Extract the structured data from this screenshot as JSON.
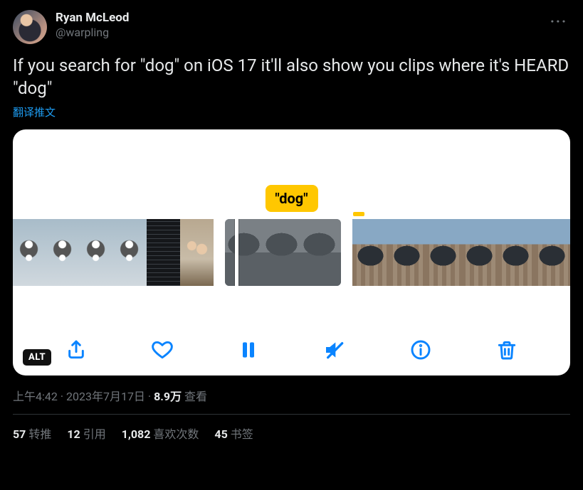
{
  "author": {
    "display_name": "Ryan McLeod",
    "handle": "@warpling"
  },
  "tweet_text": "If you search for \"dog\" on iOS 17 it'll also show you clips where it's HEARD \"dog\"",
  "translate_label": "翻译推文",
  "media": {
    "search_tooltip": "\"dog\"",
    "alt_badge": "ALT"
  },
  "meta": {
    "time": "上午4:42",
    "date": "2023年7月17日",
    "views_count": "8.9万",
    "views_label": "查看"
  },
  "stats": {
    "retweets": {
      "count": "57",
      "label": "转推"
    },
    "quotes": {
      "count": "12",
      "label": "引用"
    },
    "likes": {
      "count": "1,082",
      "label": "喜欢次数"
    },
    "bookmarks": {
      "count": "45",
      "label": "书签"
    }
  }
}
